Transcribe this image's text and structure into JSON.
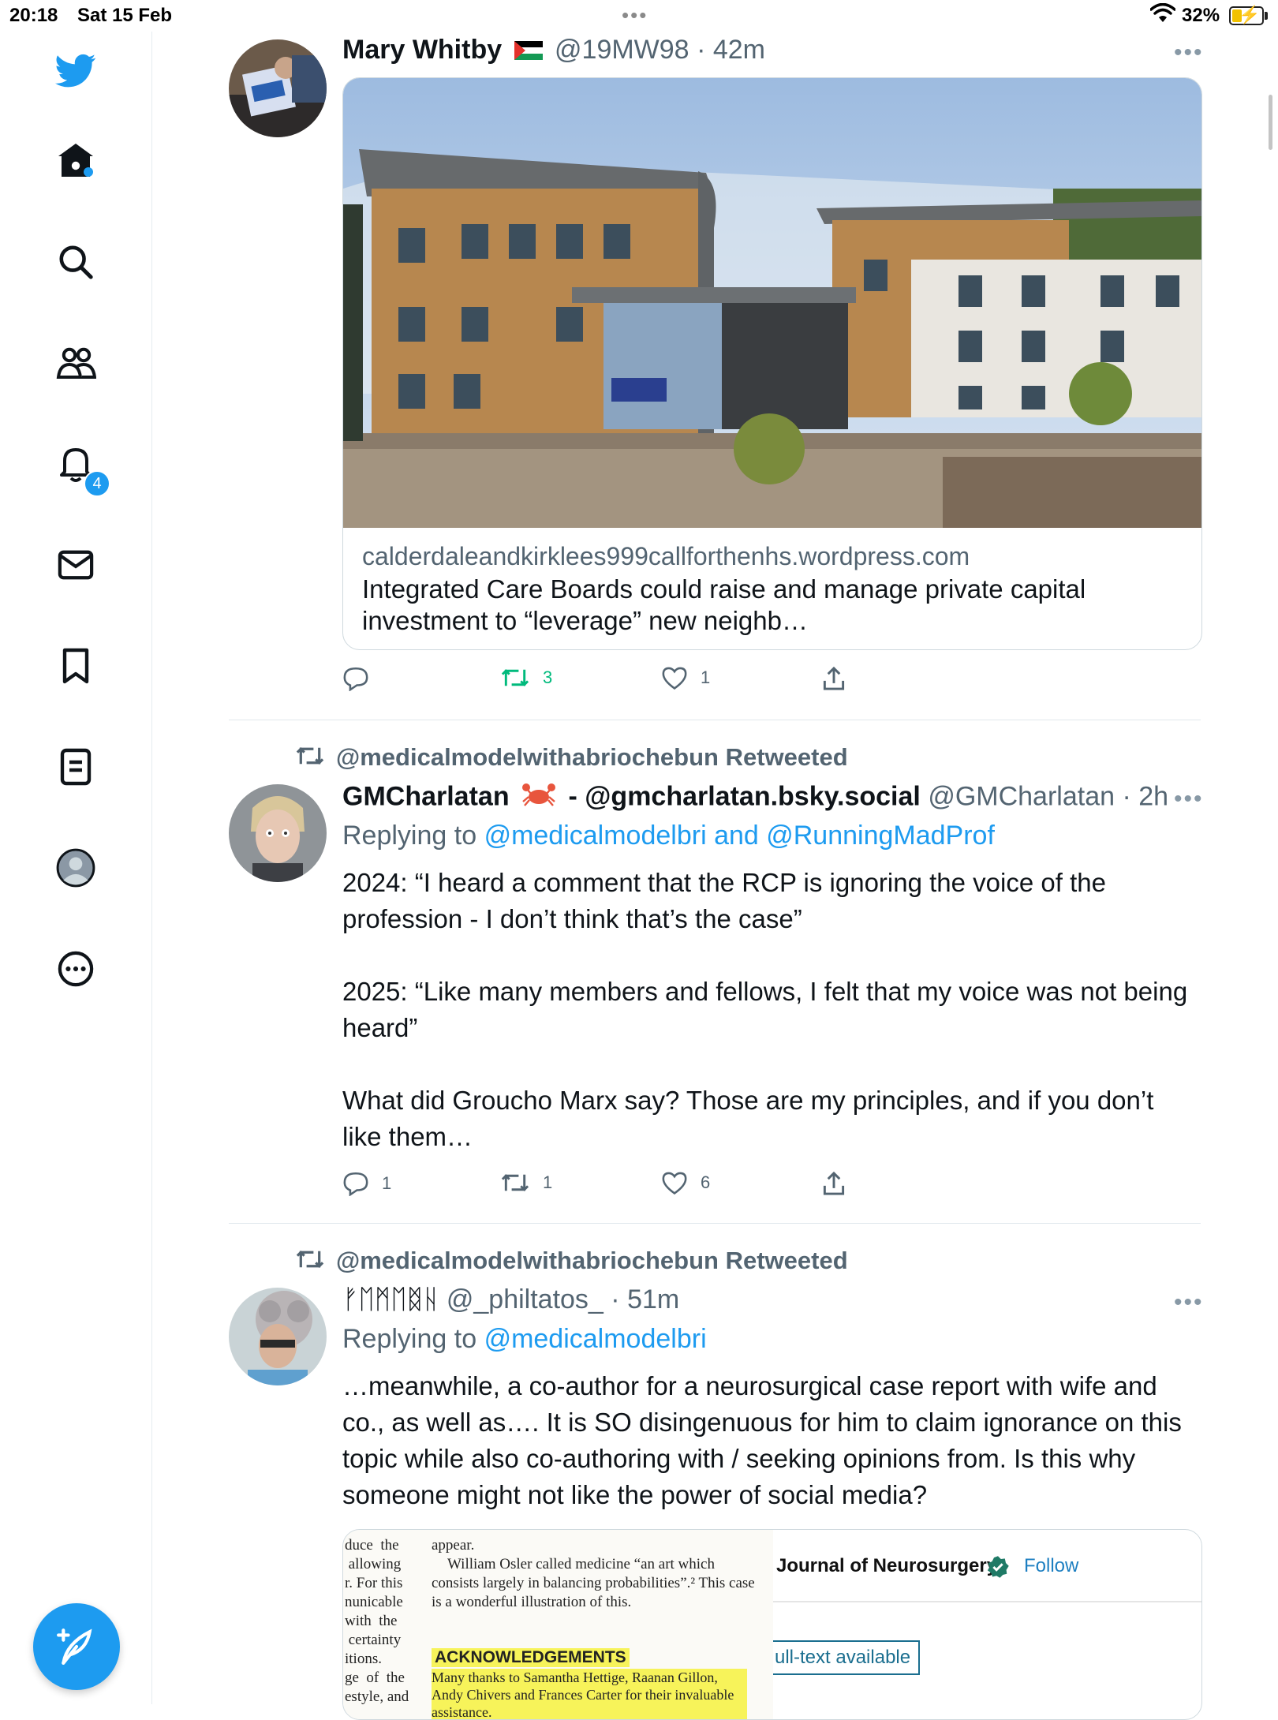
{
  "status_bar": {
    "time": "20:18",
    "date": "Sat 15 Feb",
    "battery": "32%"
  },
  "sidebar": {
    "notifications_badge": "4",
    "items": [
      {
        "icon": "twitter-logo-icon"
      },
      {
        "icon": "home-icon"
      },
      {
        "icon": "search-icon"
      },
      {
        "icon": "communities-icon"
      },
      {
        "icon": "notifications-icon"
      },
      {
        "icon": "messages-icon"
      },
      {
        "icon": "bookmarks-icon"
      },
      {
        "icon": "lists-icon"
      },
      {
        "icon": "profile-icon"
      },
      {
        "icon": "more-icon"
      }
    ],
    "compose_icon": "compose-tweet-icon"
  },
  "tweets": [
    {
      "name": "Mary Whitby",
      "flag": "🇵🇸",
      "handle": "@19MW98",
      "time": "42m",
      "card": {
        "domain": "calderdaleandkirklees999callforthenhs.wordpress.com",
        "title": "Integrated Care Boards could raise and manage private capital investment to “leverage” new neighb…"
      },
      "replies": "",
      "retweets": "3",
      "likes": "1"
    },
    {
      "retweeted_by": "@medicalmodelwithabriochebun Retweeted",
      "name": "GMCharlatan",
      "name_suffix": "- @gmcharlatan.bsky.social",
      "handle": "@GMCharlatan",
      "time": "2h",
      "replying_prefix": "Replying to",
      "replying_to": "@medicalmodelbri and @RunningMadProf",
      "text": "2024: “I heard a comment that the RCP is ignoring the voice of the profession - I don’t think that’s the case”\n\n2025: “Like many members and fellows, I felt that my voice was not being heard”\n\nWhat did Groucho Marx say? Those are my principles, and if you don’t like them…",
      "replies": "1",
      "retweets": "1",
      "likes": "6"
    },
    {
      "retweeted_by": "@medicalmodelwithabriochebun Retweeted",
      "name": "ᚠᛖᛗᛖᛥᚺ",
      "handle": "@_philtatos_",
      "time": "51m",
      "replying_prefix": "Replying to",
      "replying_to": "@medicalmodelbri",
      "text": "…meanwhile, a co-author for a neurosurgical case report with wife and co., as well as…. It is SO disingenuous for him to claim ignorance on this topic while also co-authoring with / seeking opinions from. Is this why someone might not like the power of social media?",
      "media": {
        "left_col": "duce  the\n allowing\nr. For this\nnunicable\nwith  the\n certainty\nitions.\nge  of  the\nestyle, and",
        "right_col_1": "appear.",
        "right_col_2": "William Osler called medicine “an art which consists largely in balancing probabilities”.² This case is a wonderful illustration of this.",
        "ack_heading": "ACKNOWLEDGEMENTS",
        "ack_text": "Many thanks to Samantha Hettige, Raanan Gillon, Andy Chivers and Frances Carter for their invaluable assistance.",
        "journal_name": "Journal of Neurosurgery",
        "follow_label": "Follow",
        "fulltext_label": "ull-text available"
      }
    }
  ]
}
